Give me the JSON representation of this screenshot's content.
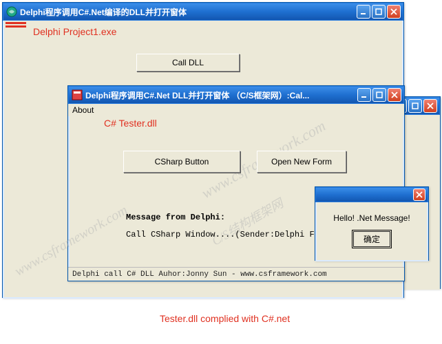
{
  "main_window": {
    "title": "Delphi程序调用C#.Net编译的DLL并打开窗体",
    "call_dll_label": "Call DLL"
  },
  "annotations": {
    "main_label": "Delphi Project1.exe",
    "child_label": "C# Tester.dll",
    "footer_label": "Tester.dll complied with C#.net"
  },
  "child_window": {
    "title": "Delphi程序调用C#.Net DLL并打开窗体 （C/S框架网）:Cal...",
    "menu_about": "About",
    "csharp_button": "CSharp Button",
    "open_form_button": "Open New Form",
    "msg_heading": "Message from Delphi:",
    "msg_body": "Call CSharp Window....(Sender:Delphi Form)",
    "status": "Delphi call C# DLL Auhor:Jonny Sun  - www.csframework.com"
  },
  "msgbox": {
    "text": "Hello! .Net Message!",
    "ok": "确定"
  },
  "back_window": {
    "title": ""
  },
  "watermarks": {
    "w1": "www.csframework.com",
    "w2": "C/S结构框架网"
  }
}
